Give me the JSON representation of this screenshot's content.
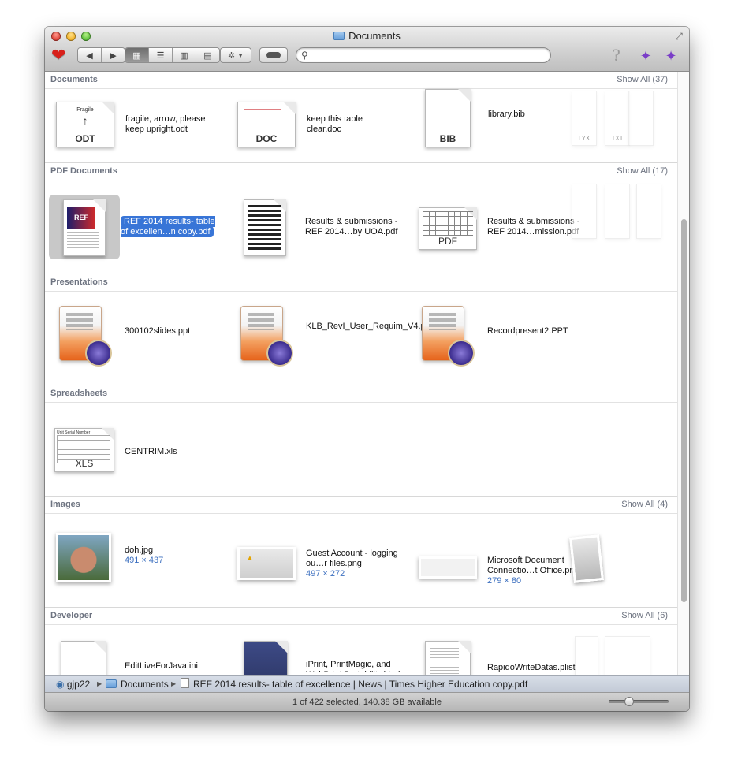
{
  "window": {
    "title": "Documents"
  },
  "toolbar": {
    "search_placeholder": "",
    "back_icon": "back-arrow-icon",
    "forward_icon": "forward-arrow-icon"
  },
  "sections": {
    "documents": {
      "title": "Documents",
      "show_all": "Show All (37)",
      "items": [
        {
          "name": "fragile, arrow, please keep upright.odt",
          "badge": "ODT",
          "preview": "Fragile"
        },
        {
          "name": "keep this table clear.doc",
          "badge": "DOC"
        },
        {
          "name": "library.bib",
          "badge": "BIB"
        }
      ],
      "ghost_badges": [
        "LYX",
        "TXT"
      ]
    },
    "pdf": {
      "title": "PDF Documents",
      "show_all": "Show All (17)",
      "items": [
        {
          "name": "REF 2014 results- table of excellen…n copy.pdf",
          "preview": "REF"
        },
        {
          "name": "Results & submissions - REF 2014…by UOA.pdf"
        },
        {
          "name": "Results & submissions - REF 2014…mission.pdf",
          "badge": "PDF"
        }
      ]
    },
    "presentations": {
      "title": "Presentations",
      "items": [
        {
          "name": "300102slides.ppt"
        },
        {
          "name": "KLB_RevI_User_Requim_V4.ppt"
        },
        {
          "name": "Recordpresent2.PPT"
        }
      ]
    },
    "spreadsheets": {
      "title": "Spreadsheets",
      "items": [
        {
          "name": "CENTRIM.xls",
          "badge": "XLS",
          "preview": "Unit Serial Number"
        }
      ]
    },
    "images": {
      "title": "Images",
      "show_all": "Show All (4)",
      "items": [
        {
          "name": "doh.jpg",
          "dims": "491 × 437"
        },
        {
          "name": "Guest Account - logging ou…r files.png",
          "dims": "497 × 272"
        },
        {
          "name": "Microsoft Document Connectio…t Office.png",
          "dims": "279 × 80"
        }
      ]
    },
    "developer": {
      "title": "Developer",
      "show_all": "Show All (6)",
      "items": [
        {
          "name": "EditLiveForJava.ini"
        },
        {
          "name": "iPrint, PrintMagic, and WebPrint Portability.html"
        },
        {
          "name": "RapidoWriteDatas.plist"
        }
      ]
    }
  },
  "pathbar": {
    "items": [
      "gjp22",
      "Documents",
      "REF 2014 results- table of excellence | News | Times Higher Education copy.pdf"
    ]
  },
  "status": {
    "text": "1 of 422 selected, 140.38 GB available",
    "icon_size_fraction": 0.33
  }
}
